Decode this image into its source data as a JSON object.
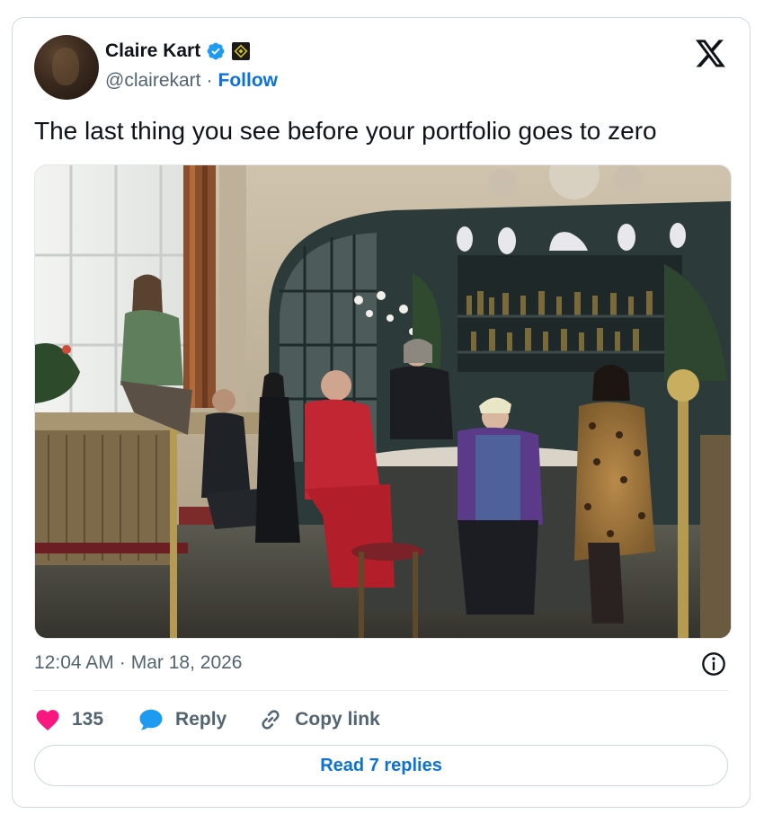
{
  "author": {
    "name": "Claire Kart",
    "handle": "@clairekart",
    "separator": "·",
    "follow_label": "Follow",
    "verified_icon": "verified-badge-icon",
    "affiliate_icon": "affiliate-badge-icon"
  },
  "platform_icon": "x-logo-icon",
  "tweet": {
    "text": "The last thing you see before your portfolio goes to zero"
  },
  "media": {
    "kind": "photo",
    "description_icon": "group-portrait-photo"
  },
  "meta": {
    "time": "12:04 AM",
    "separator": "·",
    "date": "Mar 18, 2026"
  },
  "actions": {
    "like_count": "135",
    "reply_label": "Reply",
    "copy_label": "Copy link"
  },
  "read_replies_label": "Read 7 replies",
  "colors": {
    "accent": "#0b72d6",
    "like": "#f91880",
    "reply_icon": "#1d9bf0",
    "muted": "#536471",
    "border": "#cfd9de"
  }
}
